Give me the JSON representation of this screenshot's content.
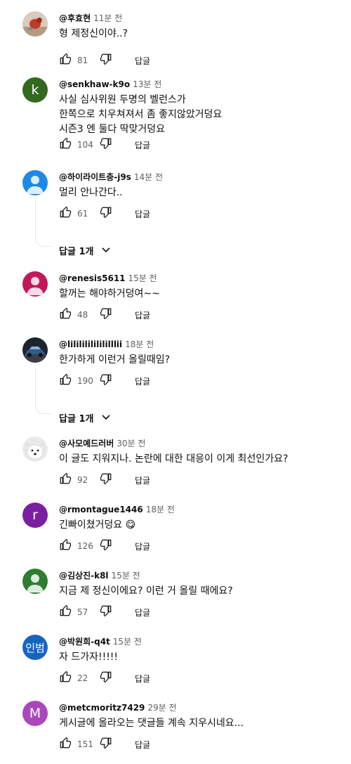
{
  "comments": [
    {
      "author": "@후효현",
      "time": "11분 전",
      "lines": [
        "형 제정신이야..?"
      ],
      "likes": "81",
      "reply_label": "답글",
      "avatar": {
        "type": "photo-bird"
      }
    },
    {
      "author": "@senkhaw-k9o",
      "time": "13분 전",
      "lines": [
        "사실 심사위원 두명의 벨런스가",
        "한쪽으로 치우쳐져서 좀 좋지않았거덩요",
        "시즌3 엔 둘다 딱맞거덩요"
      ],
      "likes": "104",
      "reply_label": "답글",
      "avatar": {
        "type": "letter",
        "letter": "k",
        "color": "#33691e"
      }
    },
    {
      "author": "@하이라이트충-j9s",
      "time": "14분 전",
      "lines": [
        "멀리 안나간다.."
      ],
      "likes": "61",
      "reply_label": "답글",
      "avatar": {
        "type": "person",
        "color": "#1e88e5"
      },
      "replies_label": "답글 1개"
    },
    {
      "author": "@renesis5611",
      "time": "15분 전",
      "lines": [
        "할꺼는 해야하거덩여~~"
      ],
      "likes": "48",
      "reply_label": "답글",
      "avatar": {
        "type": "person",
        "color": "#c2185b"
      }
    },
    {
      "author": "@lilililililililllii",
      "time": "18분 전",
      "lines": [
        "한가하게 이런거 올릴때임?"
      ],
      "likes": "190",
      "reply_label": "답글",
      "avatar": {
        "type": "photo-car"
      },
      "replies_label": "답글 1개"
    },
    {
      "author": "@사모예드러버",
      "time": "30분 전",
      "lines": [
        "이 글도 지워지나. 논란에 대한 대응이 이게 최선인가요?"
      ],
      "likes": "92",
      "reply_label": "답글",
      "avatar": {
        "type": "photo-dog"
      }
    },
    {
      "author": "@rmontague1446",
      "time": "18분 전",
      "lines": [
        "긴빠이쳤거덩요 😋"
      ],
      "likes": "126",
      "reply_label": "답글",
      "avatar": {
        "type": "letter",
        "letter": "r",
        "color": "#7b1fa2"
      }
    },
    {
      "author": "@김상진-k8l",
      "time": "15분 전",
      "lines": [
        "지금 제 정신이에요? 이런 거 올릴 때에요?"
      ],
      "likes": "57",
      "reply_label": "답글",
      "avatar": {
        "type": "person",
        "color": "#2e7d32"
      }
    },
    {
      "author": "@박원희-q4t",
      "time": "15분 전",
      "lines": [
        "자 드가자!!!!!"
      ],
      "likes": "22",
      "reply_label": "답글",
      "avatar": {
        "type": "text",
        "text": "인범",
        "color": "#1565c0"
      }
    },
    {
      "author": "@metcmoritz7429",
      "time": "29분 전",
      "lines": [
        "게시글에 올라오는 댓글들 계속 지우시네요..."
      ],
      "likes": "151",
      "reply_label": "답글",
      "avatar": {
        "type": "letter",
        "letter": "M",
        "color": "#ab47bc"
      }
    }
  ]
}
